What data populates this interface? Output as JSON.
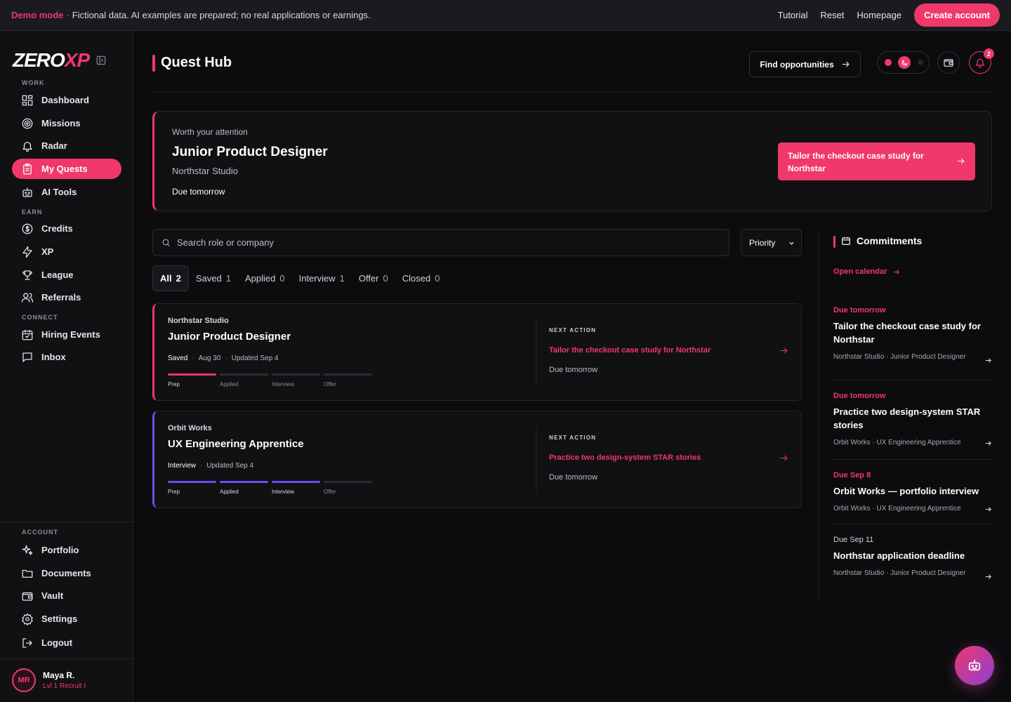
{
  "banner": {
    "demo_label": "Demo mode",
    "separator": "·",
    "note": "Fictional data. AI examples are prepared; no real applications or earnings.",
    "links": [
      "Tutorial",
      "Reset",
      "Homepage"
    ],
    "cta": "Create account"
  },
  "sidebar": {
    "logo_main": "ZERO",
    "logo_accent": "XP",
    "sections": {
      "work": "WORK",
      "earn": "EARN",
      "connect": "CONNECT",
      "account": "ACCOUNT"
    },
    "items": [
      {
        "label": "Dashboard",
        "icon": "dashboard-icon"
      },
      {
        "label": "Missions",
        "icon": "target-icon"
      },
      {
        "label": "Radar",
        "icon": "bell-icon"
      },
      {
        "label": "My Quests",
        "icon": "clipboard-icon",
        "active": true
      },
      {
        "label": "AI Tools",
        "icon": "robot-icon"
      },
      {
        "label": "Credits",
        "icon": "dollar-icon"
      },
      {
        "label": "XP",
        "icon": "bolt-icon"
      },
      {
        "label": "League",
        "icon": "trophy-icon"
      },
      {
        "label": "Referrals",
        "icon": "users-icon"
      },
      {
        "label": "Hiring Events",
        "icon": "calendar-icon"
      },
      {
        "label": "Inbox",
        "icon": "chat-icon"
      },
      {
        "label": "Portfolio",
        "icon": "sparkles-icon"
      },
      {
        "label": "Documents",
        "icon": "folder-icon"
      },
      {
        "label": "Vault",
        "icon": "wallet-icon"
      },
      {
        "label": "Settings",
        "icon": "gear-icon"
      },
      {
        "label": "Logout",
        "icon": "logout-icon"
      }
    ],
    "user": {
      "initials": "MR",
      "name": "Maya R.",
      "rank": "Lvl 1 Recruit I"
    }
  },
  "header": {
    "title": "Quest Hub",
    "find_label": "Find opportunities",
    "notifications": "2"
  },
  "hero": {
    "eyebrow": "Worth your attention",
    "title": "Junior Product Designer",
    "company": "Northstar Studio",
    "due": "Due tomorrow",
    "cta": "Tailor the checkout case study for Northstar"
  },
  "search": {
    "placeholder": "Search role or company"
  },
  "sort": {
    "selected": "Priority"
  },
  "tabs": [
    {
      "label": "All",
      "count": "2",
      "active": true
    },
    {
      "label": "Saved",
      "count": "1"
    },
    {
      "label": "Applied",
      "count": "0"
    },
    {
      "label": "Interview",
      "count": "1"
    },
    {
      "label": "Offer",
      "count": "0"
    },
    {
      "label": "Closed",
      "count": "0"
    }
  ],
  "quests": [
    {
      "company": "Northstar Studio",
      "role": "Junior Product Designer",
      "meta": [
        "Saved",
        "Aug 30",
        "Updated Sep 4"
      ],
      "stages": [
        "Prep",
        "Applied",
        "Interview",
        "Offer"
      ],
      "stages_completed": 1,
      "accent": "#f0386b",
      "next_action_label": "NEXT ACTION",
      "next_action": "Tailor the checkout case study for Northstar",
      "due": "Due tomorrow"
    },
    {
      "company": "Orbit Works",
      "role": "UX Engineering Apprentice",
      "meta": [
        "Interview",
        "Updated Sep 4"
      ],
      "stages": [
        "Prep",
        "Applied",
        "Interview",
        "Offer"
      ],
      "stages_completed": 3,
      "accent": "#6a4df0",
      "next_action_label": "NEXT ACTION",
      "next_action": "Practice two design-system STAR stories",
      "due": "Due tomorrow"
    }
  ],
  "commitments": {
    "title": "Commitments",
    "open_calendar": "Open calendar",
    "items": [
      {
        "due": "Due tomorrow",
        "title": "Tailor the checkout case study for Northstar",
        "meta": "Northstar Studio · Junior Product Designer",
        "urgent": true
      },
      {
        "due": "Due tomorrow",
        "title": "Practice two design-system STAR stories",
        "meta": "Orbit Works · UX Engineering Apprentice",
        "urgent": true
      },
      {
        "due": "Due Sep 8",
        "title": "Orbit Works — portfolio interview",
        "meta": "Orbit Works · UX Engineering Apprentice",
        "urgent": true
      },
      {
        "due": "Due Sep 11",
        "title": "Northstar application deadline",
        "meta": "Northstar Studio · Junior Product Designer",
        "urgent": false
      }
    ]
  },
  "colors": {
    "accent": "#f0386b",
    "secondary": "#6a4df0",
    "background": "#0c0c0e"
  }
}
